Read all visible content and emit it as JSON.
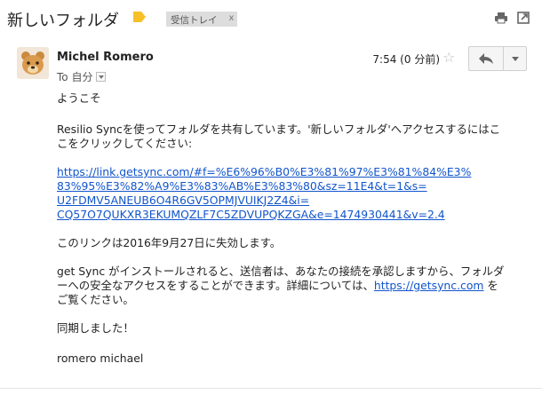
{
  "subject": "新しいフォルダ",
  "label_chip": {
    "text": "受信トレイ",
    "close": "x"
  },
  "message": {
    "sender": "Michel Romero",
    "to_label": "To 自分",
    "time": "7:54 (0 分前)",
    "star": "☆"
  },
  "body": {
    "greeting": "ようこそ",
    "intro_line1": "Resilio Syncを使ってフォルダを共有しています。'新しいフォルダ'へアクセスするにはこ",
    "intro_line2": "こをクリックしてください:",
    "link_line1": "https://link.getsync.com/#f=%E6%96%B0%E3%81%97%E3%81%84%E3%",
    "link_line2": "83%95%E3%82%A9%E3%83%AB%E3%83%80&sz=11E4&t=1&s=",
    "link_line3": "U2FDMV5ANEUB6O4R6GV5OPMJVUIKJ2Z4&i=",
    "link_line4": "CQ57O7QUKXR3EKUMQZLF7C5ZDVUPQKZGA&e=1474930441&v=2.4",
    "expiry": "このリンクは2016年9月27日に失効します。",
    "install_line1": "get Sync がインストールされると、送信者は、あなたの接続を承認しますから、フォルダ",
    "install_line2_pre": "ーへの安全なアクセスをすることができます。詳細については、",
    "install_link": "https://getsync.com",
    "install_line2_post": " を",
    "install_line3": "ご覧ください。",
    "thanks": "同期しました！",
    "signature": "romero michael"
  },
  "colors": {
    "link": "#1155cc",
    "label_tag": "#f6c026",
    "chip_bg": "#dddddd"
  },
  "icons": [
    "label-tag-icon",
    "print-icon",
    "new-window-icon",
    "reply-icon",
    "more-caret-icon",
    "star-icon"
  ]
}
